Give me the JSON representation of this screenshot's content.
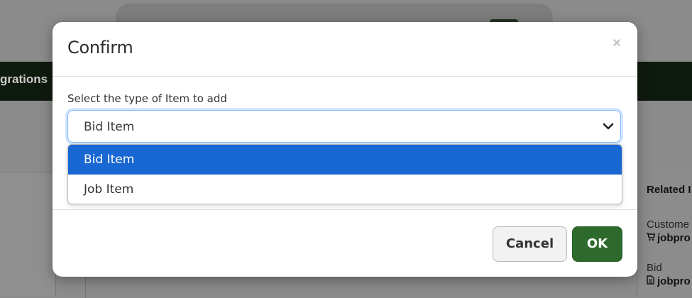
{
  "background": {
    "nav_label": "grations",
    "related_heading": "Related I",
    "customer_label": "Custome",
    "customer_link": "jobpro",
    "bid_label": "Bid",
    "bid_link": "jobpro"
  },
  "modal": {
    "title": "Confirm",
    "close_symbol": "×",
    "field_label": "Select the type of Item to add",
    "select": {
      "selected_value": "Bid Item",
      "options": [
        {
          "label": "Bid Item",
          "selected": true
        },
        {
          "label": "Job Item",
          "selected": false
        }
      ]
    },
    "buttons": {
      "cancel_label": "Cancel",
      "ok_label": "OK"
    }
  },
  "colors": {
    "primary_green": "#2e6a2e",
    "highlight_blue": "#1967d2",
    "navbar_dark": "#0f1a0f"
  },
  "icons": [
    "close-icon",
    "chevron-down-icon",
    "cart-icon",
    "document-icon"
  ]
}
